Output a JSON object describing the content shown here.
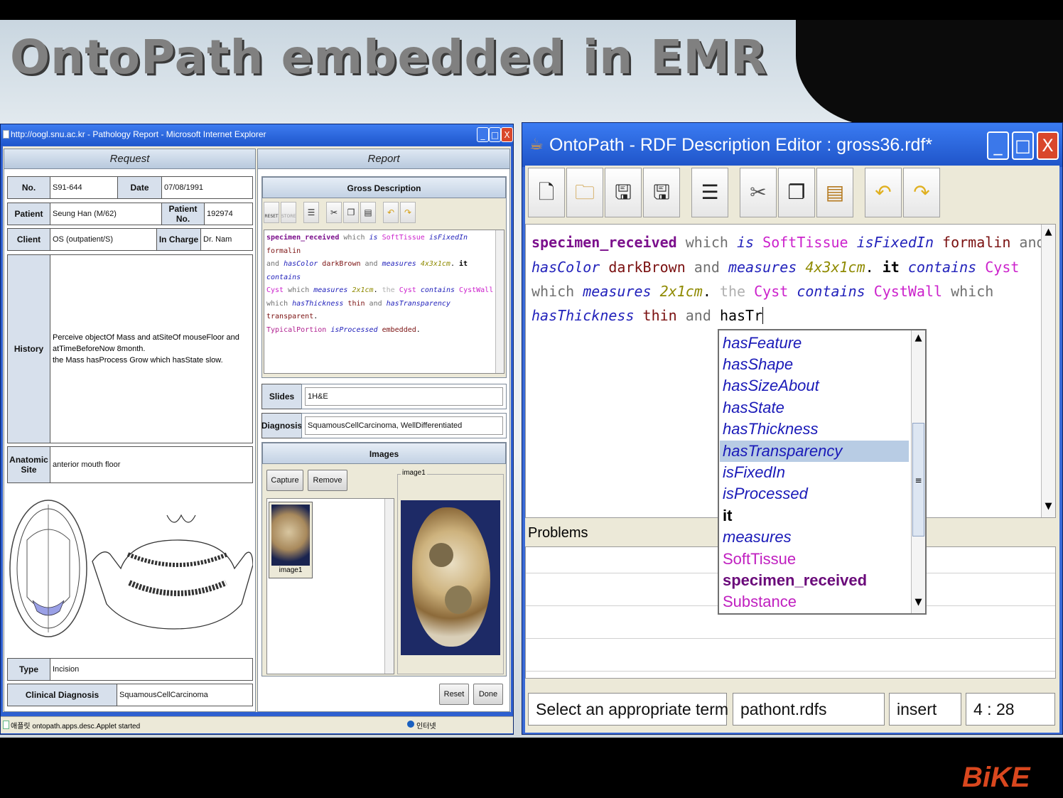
{
  "slide": {
    "title": "OntoPath embedded in EMR",
    "logo": "BiKE"
  },
  "ie": {
    "title": "http://oogl.snu.ac.kr - Pathology Report - Microsoft Internet Explorer",
    "controls": [
      "_",
      "□",
      "X"
    ],
    "status_text": "애플릿 ontopath.apps.desc.Applet started",
    "status_zone": "인터넷",
    "request": {
      "header": "Request",
      "no_label": "No.",
      "no_value": "S91-644",
      "date_label": "Date",
      "date_value": "07/08/1991",
      "patient_label": "Patient",
      "patient_value": "Seung Han (M/62)",
      "patient_no_label": "Patient No.",
      "patient_no_value": "192974",
      "client_label": "Client",
      "client_value": "OS (outpatient/S)",
      "in_charge_label": "In Charge",
      "in_charge_value": "Dr. Nam",
      "history_label": "History",
      "history_line1": "Perceive objectOf Mass and atSiteOf mouseFloor and",
      "history_line2": "atTimeBeforeNow 8month.",
      "history_line3": "the Mass hasProcess Grow which hasState slow.",
      "anatomic_label_1": "Anatomic",
      "anatomic_label_2": "Site",
      "anatomic_value": "anterior mouth floor",
      "type_label": "Type",
      "type_value": "Incision",
      "clinical_label": "Clinical Diagnosis",
      "clinical_value": "SquamousCellCarcinoma"
    },
    "report": {
      "header": "Report",
      "gross_header": "Gross Description",
      "toolbar_reset": "RESET",
      "toolbar_store": "STORE",
      "slides_label": "Slides",
      "slides_value": "1H&E",
      "diagnosis_label": "Diagnosis",
      "diagnosis_value": "SquamousCellCarcinoma, WellDifferentiated",
      "images_header": "Images",
      "capture_button": "Capture",
      "remove_button": "Remove",
      "thumb_caption": "image1",
      "preview_label": "image1",
      "reset_button": "Reset",
      "done_button": "Done"
    }
  },
  "ontopath": {
    "title": "OntoPath - RDF Description Editor : gross36.rdf*",
    "controls": [
      "_",
      "□",
      "X"
    ],
    "toolbar_icons": [
      "new-file-icon",
      "open-folder-icon",
      "save-icon",
      "save-all-icon",
      "template-icon",
      "cut-icon",
      "copy-icon",
      "paste-icon",
      "undo-icon",
      "redo-icon"
    ],
    "problems_label": "Problems",
    "status_message": "Select an appropriate term",
    "status_schema": "pathont.rdfs",
    "status_mode": "insert",
    "status_position": "4 : 28",
    "autocomplete": [
      {
        "label": "hasFeature",
        "style": "property"
      },
      {
        "label": "hasShape",
        "style": "property"
      },
      {
        "label": "hasSizeAbout",
        "style": "property"
      },
      {
        "label": "hasState",
        "style": "property"
      },
      {
        "label": "hasThickness",
        "style": "property"
      },
      {
        "label": "hasTransparency",
        "style": "property",
        "selected": true
      },
      {
        "label": "isFixedIn",
        "style": "property"
      },
      {
        "label": "isProcessed",
        "style": "property"
      },
      {
        "label": "it",
        "style": "keyword"
      },
      {
        "label": "measures",
        "style": "property"
      },
      {
        "label": "SoftTissue",
        "style": "class"
      },
      {
        "label": "specimen_received",
        "style": "instance"
      },
      {
        "label": "Substance",
        "style": "class"
      }
    ]
  },
  "colors": {
    "xp_blue": "#2d5fd0",
    "accent_logo": "#d9471e",
    "selected_row": "#b8cce4"
  }
}
